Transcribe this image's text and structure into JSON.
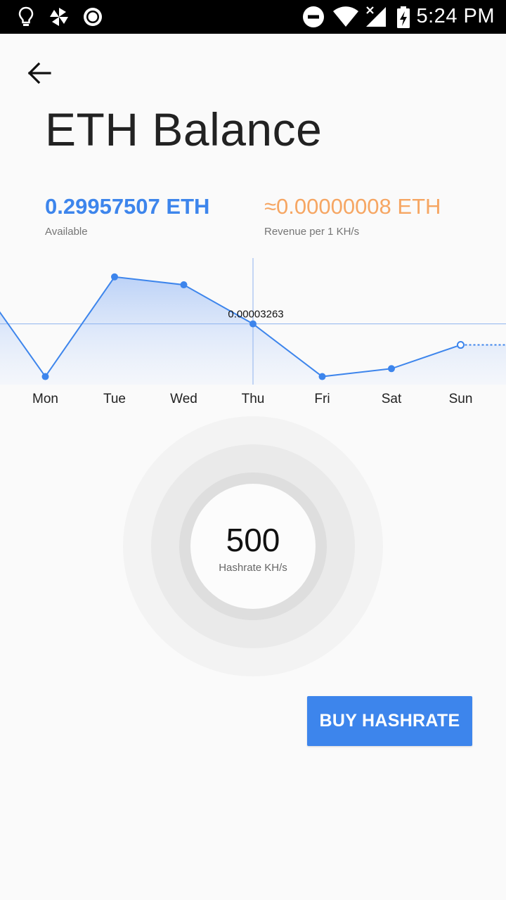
{
  "status_bar": {
    "time": "5:24 PM",
    "left_icons": [
      "lightbulb-icon",
      "pinwheel-icon",
      "record-icon"
    ],
    "right_icons": [
      "do-not-disturb-icon",
      "wifi-icon",
      "cell-signal-icon",
      "battery-charging-icon"
    ]
  },
  "header": {
    "back_icon": "arrow-left-icon",
    "title": "ETH Balance"
  },
  "stats": {
    "available": {
      "value": "0.29957507 ETH",
      "label": "Available"
    },
    "revenue": {
      "value": "≈0.00000008 ETH",
      "label": "Revenue per 1 KH/s"
    }
  },
  "colors": {
    "accent": "#3d85ec",
    "revenue": "#f6a663",
    "background": "#fafafa"
  },
  "chart_data": {
    "type": "area",
    "categories": [
      "Mon",
      "Tue",
      "Wed",
      "Thu",
      "Fri",
      "Sat",
      "Sun"
    ],
    "series": [
      {
        "values": [
          9e-07,
          7.2e-06,
          6.7e-06,
          3.263e-05,
          9e-07,
          1.4e-06,
          2.9e-06
        ]
      }
    ],
    "selected": {
      "category": "Thu",
      "label": "0.00003263"
    },
    "grid": false
  },
  "hashrate": {
    "value": "500",
    "label": "Hashrate KH/s"
  },
  "actions": {
    "buy_label": "BUY HASHRATE"
  }
}
